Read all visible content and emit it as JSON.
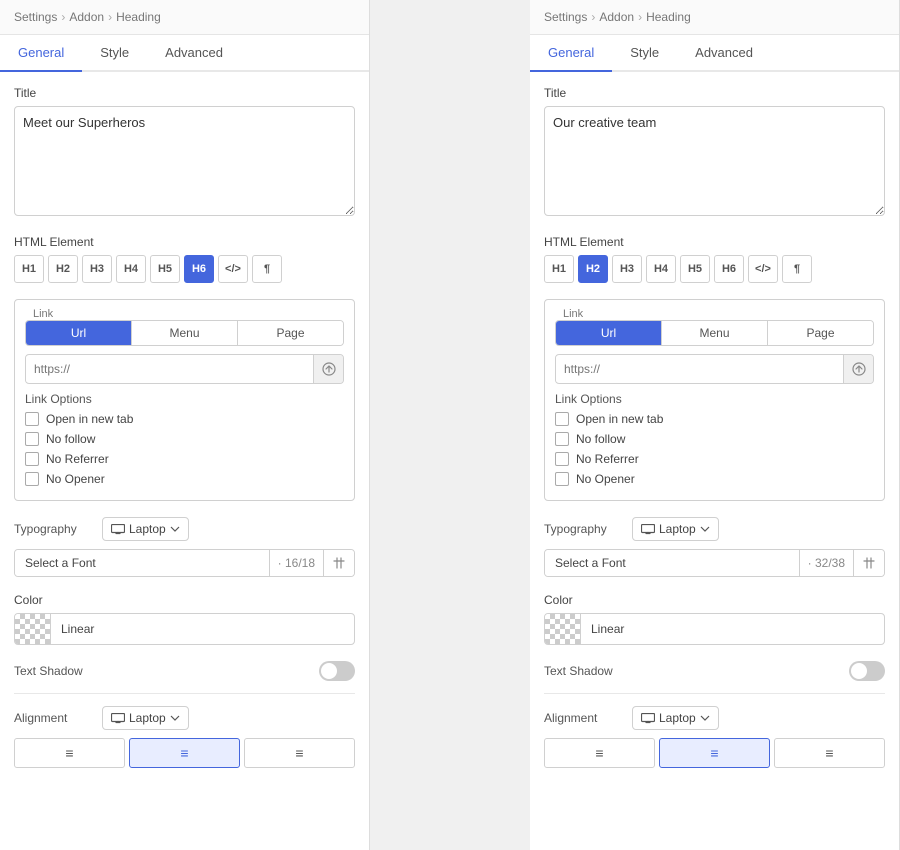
{
  "panel1": {
    "breadcrumb": [
      "Settings",
      "Addon",
      "Heading"
    ],
    "tabs": [
      "General",
      "Style",
      "Advanced"
    ],
    "active_tab": "General",
    "title_label": "Title",
    "title_value": "Meet our Superheros",
    "html_element_label": "HTML Element",
    "html_buttons": [
      "H1",
      "H2",
      "H3",
      "H4",
      "H5",
      "H6",
      "</>",
      "¶"
    ],
    "active_html_btn": "H6",
    "link_label": "Link",
    "link_tabs": [
      "Url",
      "Menu",
      "Page"
    ],
    "active_link_tab": "Url",
    "url_placeholder": "https://",
    "link_options_label": "Link Options",
    "checkboxes": [
      "Open in new tab",
      "No follow",
      "No Referrer",
      "No Opener"
    ],
    "typography_label": "Typography",
    "device_label": "Laptop",
    "font_label": "Select a Font",
    "font_size": "16/18",
    "color_label": "Color",
    "color_value": "Linear",
    "text_shadow_label": "Text Shadow",
    "text_shadow_on": false,
    "alignment_label": "Alignment",
    "alignment_device": "Laptop",
    "alignment_options": [
      "left",
      "center",
      "right"
    ],
    "active_alignment": "center"
  },
  "panel2": {
    "breadcrumb": [
      "Settings",
      "Addon",
      "Heading"
    ],
    "tabs": [
      "General",
      "Style",
      "Advanced"
    ],
    "active_tab": "General",
    "title_label": "Title",
    "title_value": "Our creative team",
    "html_element_label": "HTML Element",
    "html_buttons": [
      "H1",
      "H2",
      "H3",
      "H4",
      "H5",
      "H6",
      "</>",
      "¶"
    ],
    "active_html_btn": "H2",
    "link_label": "Link",
    "link_tabs": [
      "Url",
      "Menu",
      "Page"
    ],
    "active_link_tab": "Url",
    "url_placeholder": "https://",
    "link_options_label": "Link Options",
    "checkboxes": [
      "Open in new tab",
      "No follow",
      "No Referrer",
      "No Opener"
    ],
    "typography_label": "Typography",
    "device_label": "Laptop",
    "font_label": "Select a Font",
    "font_size": "32/38",
    "color_label": "Color",
    "color_value": "Linear",
    "text_shadow_label": "Text Shadow",
    "text_shadow_on": false,
    "alignment_label": "Alignment",
    "alignment_device": "Laptop",
    "alignment_options": [
      "left",
      "center",
      "right"
    ],
    "active_alignment": "center"
  }
}
